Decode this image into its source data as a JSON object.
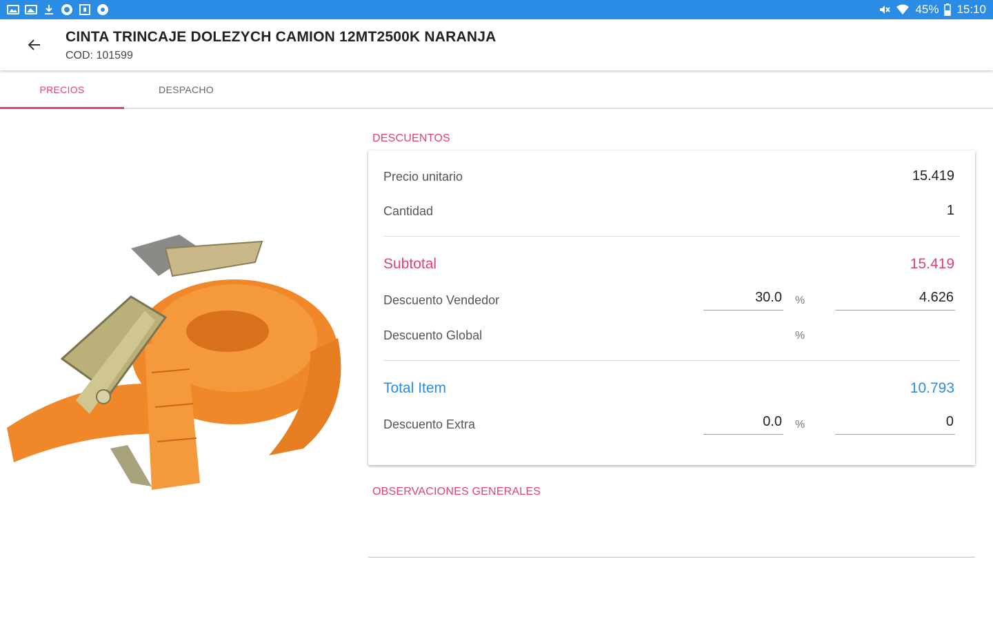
{
  "status_bar": {
    "battery": "45%",
    "time": "15:10"
  },
  "header": {
    "title": "CINTA TRINCAJE DOLEZYCH CAMION 12MT2500K NARANJA",
    "code": "COD: 101599"
  },
  "tabs": [
    {
      "label": "PRECIOS",
      "active": true
    },
    {
      "label": "DESPACHO",
      "active": false
    }
  ],
  "descuentos": {
    "header": "DESCUENTOS",
    "precio_unitario": {
      "label": "Precio unitario",
      "value": "15.419"
    },
    "cantidad": {
      "label": "Cantidad",
      "value": "1"
    },
    "subtotal": {
      "label": "Subtotal",
      "value": "15.419"
    },
    "descuento_vendedor": {
      "label": "Descuento Vendedor",
      "percent": "30.0",
      "percent_symbol": "%",
      "amount": "4.626"
    },
    "descuento_global": {
      "label": "Descuento Global",
      "percent_symbol": "%"
    },
    "total_item": {
      "label": "Total Item",
      "value": "10.793"
    },
    "descuento_extra": {
      "label": "Descuento Extra",
      "percent": "0.0",
      "percent_symbol": "%",
      "amount": "0"
    }
  },
  "observaciones": {
    "header": "OBSERVACIONES GENERALES"
  },
  "colors": {
    "status_bar": "#2b8ce6",
    "accent_pink": "#e0407a",
    "accent_blue": "#2b8ce6",
    "strap_orange": "#f0882a"
  }
}
